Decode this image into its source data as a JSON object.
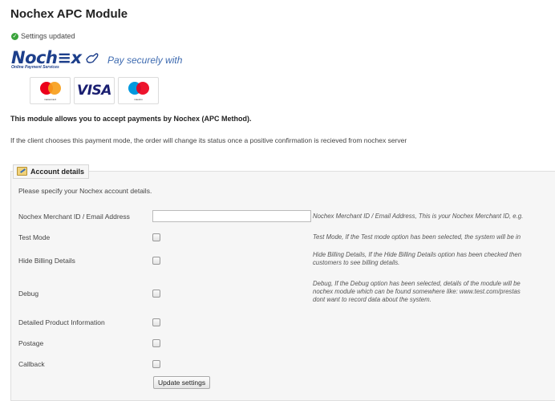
{
  "page": {
    "title": "Nochex APC Module",
    "status_message": "Settings updated",
    "status_icon": "check-circle-icon"
  },
  "logo": {
    "wordmark": "Noch≡x",
    "subtitle": "Online Payment Services",
    "tagline": "Pay securely with",
    "brand_color": "#1d3f8b"
  },
  "cards": [
    {
      "name": "mastercard",
      "label": "mastercard"
    },
    {
      "name": "visa",
      "label": "VISA"
    },
    {
      "name": "maestro",
      "label": "maestro"
    }
  ],
  "intro": "This module allows you to accept payments by Nochex (APC Method).",
  "description": "If the client chooses this payment mode, the order will change its status once a positive confirmation is recieved from nochex server",
  "account": {
    "legend": "Account details",
    "instructions": "Please specify your Nochex account details.",
    "fields": {
      "merchant_id": {
        "label": "Nochex Merchant ID / Email Address",
        "value": "",
        "help": "Nochex Merchant ID / Email Address, This is your Nochex Merchant ID, e.g."
      },
      "test_mode": {
        "label": "Test Mode",
        "checked": false,
        "help": "Test Mode, If the Test mode option has been selected, the system will be in"
      },
      "hide_billing": {
        "label": "Hide Billing Details",
        "checked": false,
        "help_lines": [
          "Hide Billing Details, If the Hide Billing Details option has been checked then",
          "customers to see billing details."
        ]
      },
      "debug": {
        "label": "Debug",
        "checked": false,
        "help_lines": [
          "Debug, If the Debug option has been selected, details of the module will be",
          "nochex module which can be found somewhere like: www.test.com/prestas",
          "dont want to record data about the system."
        ]
      },
      "detailed_product": {
        "label": "Detailed Product Information",
        "checked": false
      },
      "postage": {
        "label": "Postage",
        "checked": false
      },
      "callback": {
        "label": "Callback",
        "checked": false
      }
    },
    "submit_label": "Update settings"
  }
}
